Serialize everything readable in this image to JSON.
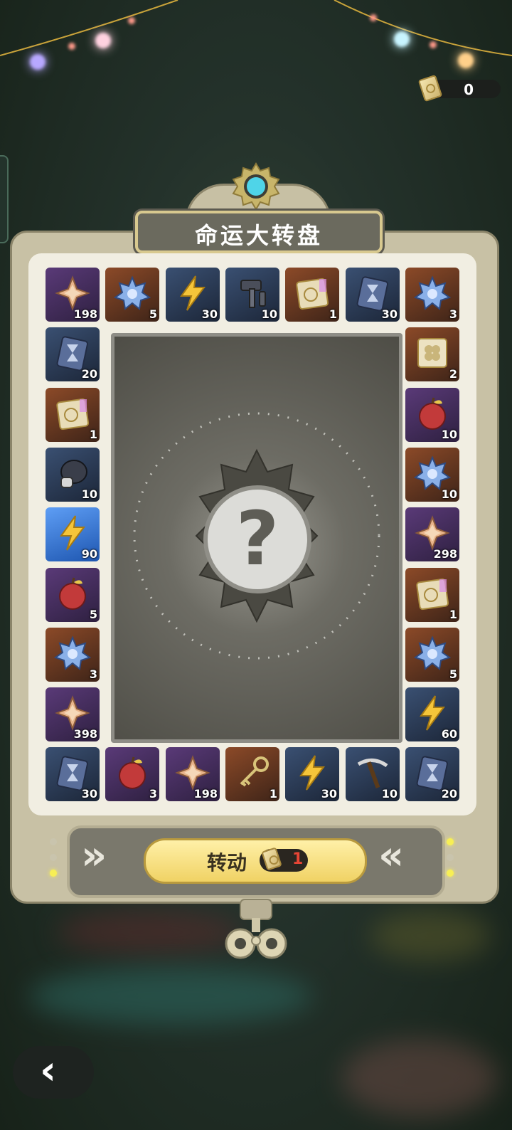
{
  "header": {
    "ticket_icon": "ticket-icon",
    "ticket_count": "0"
  },
  "title": "命运大转盘",
  "center": {
    "icon": "question-mark-icon",
    "text": "?"
  },
  "board": [
    {
      "icon": "star-crystal",
      "bg": "purple",
      "qty": "198"
    },
    {
      "icon": "blue-crystal",
      "bg": "orange",
      "qty": "5"
    },
    {
      "icon": "lightning",
      "bg": "blue",
      "qty": "30"
    },
    {
      "icon": "hammer-tools",
      "bg": "blue",
      "qty": "10"
    },
    {
      "icon": "rainbow-ticket",
      "bg": "orange",
      "qty": "1"
    },
    {
      "icon": "hourglass-card",
      "bg": "blue",
      "qty": "30"
    },
    {
      "icon": "blue-crystal",
      "bg": "orange",
      "qty": "3"
    },
    {
      "icon": "clover-ticket",
      "bg": "orange",
      "qty": "2"
    },
    {
      "icon": "apple",
      "bg": "purple",
      "qty": "10"
    },
    {
      "icon": "blue-crystal",
      "bg": "orange",
      "qty": "10"
    },
    {
      "icon": "star-crystal",
      "bg": "purple",
      "qty": "298"
    },
    {
      "icon": "rainbow-ticket",
      "bg": "orange",
      "qty": "1"
    },
    {
      "icon": "blue-crystal",
      "bg": "orange",
      "qty": "5"
    },
    {
      "icon": "lightning",
      "bg": "blue",
      "qty": "60"
    },
    {
      "icon": "hourglass-card",
      "bg": "blue",
      "qty": "20"
    },
    {
      "icon": "pickaxe",
      "bg": "blue",
      "qty": "10"
    },
    {
      "icon": "lightning",
      "bg": "blue",
      "qty": "30"
    },
    {
      "icon": "key",
      "bg": "orange",
      "qty": "1"
    },
    {
      "icon": "star-crystal",
      "bg": "purple",
      "qty": "198"
    },
    {
      "icon": "apple",
      "bg": "purple",
      "qty": "3"
    },
    {
      "icon": "hourglass-card",
      "bg": "blue",
      "qty": "30"
    },
    {
      "icon": "star-crystal",
      "bg": "purple",
      "qty": "398"
    },
    {
      "icon": "blue-crystal",
      "bg": "orange",
      "qty": "3"
    },
    {
      "icon": "apple",
      "bg": "purple",
      "qty": "5"
    },
    {
      "icon": "lightning",
      "bg": "highlight",
      "qty": "90",
      "selected": true
    },
    {
      "icon": "dark-glove",
      "bg": "blue",
      "qty": "10"
    },
    {
      "icon": "rainbow-ticket",
      "bg": "orange",
      "qty": "1"
    },
    {
      "icon": "hourglass-card",
      "bg": "blue",
      "qty": "20"
    }
  ],
  "spin_button": {
    "label": "转动",
    "cost": "1",
    "cost_icon": "ticket-icon"
  },
  "controls": {
    "left_arrow": "»",
    "right_arrow": "«"
  },
  "back_button": {
    "icon": "chevron-left-icon",
    "glyph": "‹"
  },
  "colors": {
    "cost": "#e74535",
    "highlight": "#4a8ff0",
    "gold": "#f0d264"
  }
}
